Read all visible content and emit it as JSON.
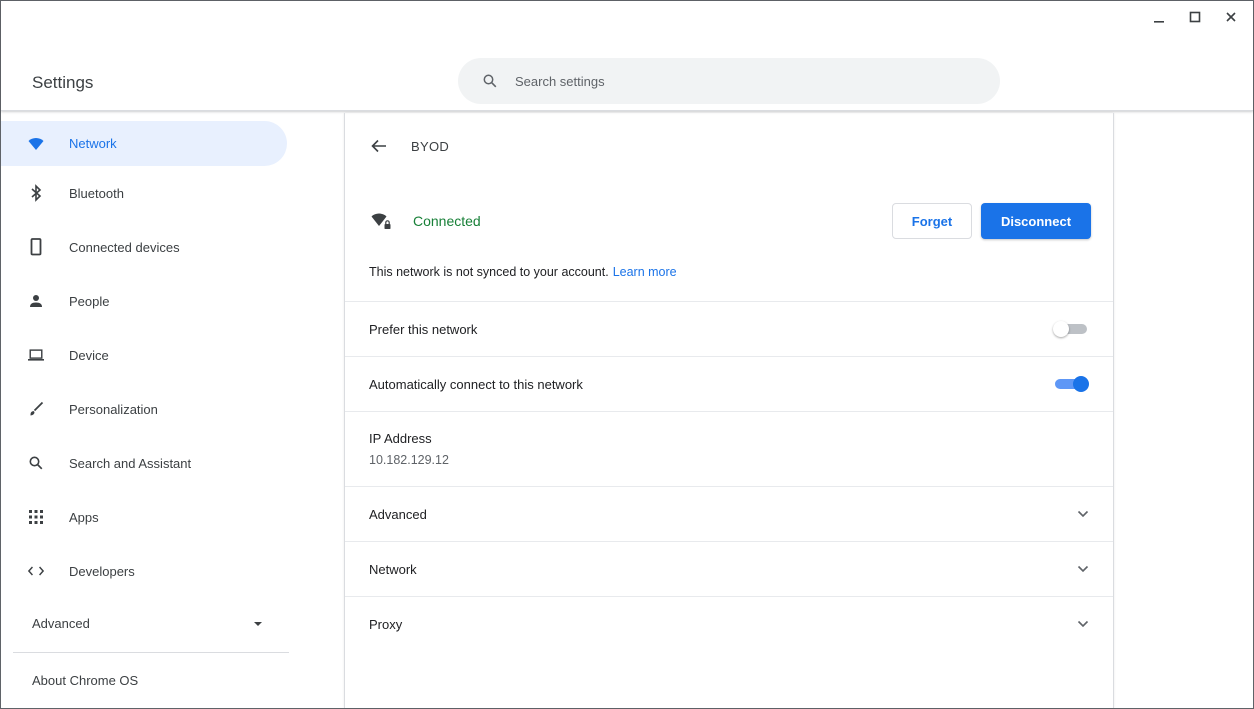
{
  "app": {
    "title": "Settings"
  },
  "search": {
    "placeholder": "Search settings"
  },
  "sidebar": {
    "items": [
      {
        "label": "Network",
        "icon": "wifi-icon",
        "active": true
      },
      {
        "label": "Bluetooth",
        "icon": "bluetooth-icon"
      },
      {
        "label": "Connected devices",
        "icon": "phone-icon"
      },
      {
        "label": "People",
        "icon": "person-icon"
      },
      {
        "label": "Device",
        "icon": "laptop-icon"
      },
      {
        "label": "Personalization",
        "icon": "brush-icon"
      },
      {
        "label": "Search and Assistant",
        "icon": "search-icon"
      },
      {
        "label": "Apps",
        "icon": "apps-grid-icon"
      },
      {
        "label": "Developers",
        "icon": "code-icon"
      }
    ],
    "advanced_label": "Advanced",
    "about_label": "About Chrome OS"
  },
  "main": {
    "title": "BYOD",
    "status": "Connected",
    "forget_label": "Forget",
    "disconnect_label": "Disconnect",
    "sync_text": "This network is not synced to your account.",
    "learn_more": "Learn more",
    "prefer_label": "Prefer this network",
    "prefer_on": false,
    "autoconnect_label": "Automatically connect to this network",
    "autoconnect_on": true,
    "ip_label": "IP Address",
    "ip_value": "10.182.129.12",
    "sections": [
      "Advanced",
      "Network",
      "Proxy"
    ]
  },
  "colors": {
    "accent": "#1a73e8",
    "connected": "#188038",
    "active_bg": "#e8f0fe"
  }
}
